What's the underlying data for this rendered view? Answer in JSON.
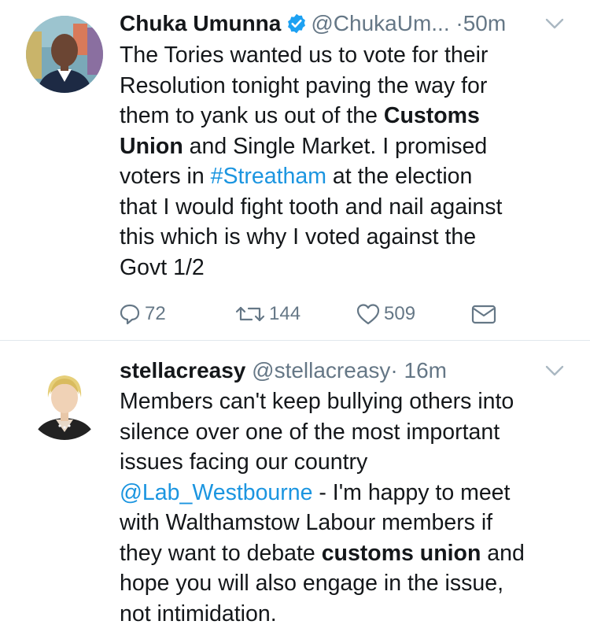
{
  "tweets": [
    {
      "name": "Chuka Umunna",
      "verified": true,
      "handle": "@ChukaUm...",
      "dot": "·",
      "time": "50m",
      "lines": [
        [
          {
            "t": "The Tories wanted us to vote for their"
          }
        ],
        [
          {
            "t": "Resolution tonight paving the way for"
          }
        ],
        [
          {
            "t": "them to yank us out of the "
          },
          {
            "t": "Customs",
            "b": true
          }
        ],
        [
          {
            "t": "Union",
            "b": true
          },
          {
            "t": " and Single Market. I promised"
          }
        ],
        [
          {
            "t": "voters in "
          },
          {
            "t": "#Streatham",
            "link": true
          },
          {
            "t": " at the election"
          }
        ],
        [
          {
            "t": "that I would fight tooth and nail against"
          }
        ],
        [
          {
            "t": "this which is why I voted against the"
          }
        ],
        [
          {
            "t": "Govt 1/2"
          }
        ]
      ],
      "actions": {
        "replies": "72",
        "retweets": "144",
        "likes": "509"
      }
    },
    {
      "name": "stellacreasy",
      "verified": false,
      "handle": "@stellacreasy",
      "dot": "·",
      "time": "16m",
      "lines": [
        [
          {
            "t": "Members can't keep bullying others into"
          }
        ],
        [
          {
            "t": "silence over one of the most important"
          }
        ],
        [
          {
            "t": "issues facing our country"
          }
        ],
        [
          {
            "t": "@Lab_Westbourne",
            "link": true
          },
          {
            "t": " - I'm happy to meet"
          }
        ],
        [
          {
            "t": "with Walthamstow Labour members if"
          }
        ],
        [
          {
            "t": "they want to debate "
          },
          {
            "t": "customs union",
            "b": true
          },
          {
            "t": " and"
          }
        ],
        [
          {
            "t": "hope you will also engage in the issue,"
          }
        ],
        [
          {
            "t": "not intimidation."
          }
        ]
      ]
    }
  ],
  "colors": {
    "link": "#1b95e0",
    "verified": "#1da1f2",
    "muted": "#657786",
    "divider": "#e1e8ed"
  },
  "icons": [
    "reply-icon",
    "retweet-icon",
    "like-icon",
    "direct-message-icon",
    "verified-badge-icon",
    "caret-down-icon"
  ]
}
